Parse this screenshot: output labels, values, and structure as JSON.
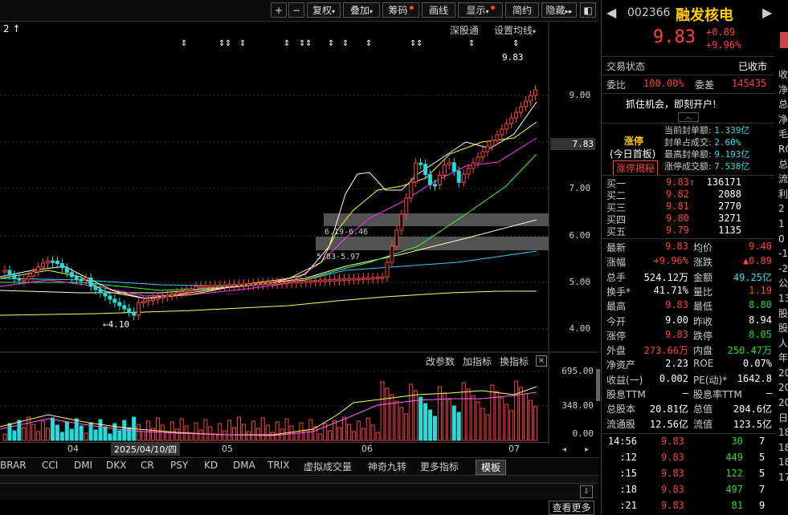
{
  "toolbar": {
    "plus": "+",
    "minus": "−",
    "fuquan": "复权",
    "diejia": "叠加",
    "chouma": "筹码",
    "huaxian": "画线",
    "xianshi": "显示",
    "jianling": "简约",
    "yincang": "隐藏"
  },
  "chart": {
    "top_left_indicator": "2 ↑",
    "shengutong": "深股通",
    "setting_ma": "设置均线",
    "y_ticks": [
      "9.00",
      "8.00",
      "7.00",
      "6.00",
      "5.00",
      "4.00"
    ],
    "current_price_tag": "7.83",
    "high_label": "9.83",
    "low_label": "4.10",
    "gap1_label": "6.19-6.46",
    "gap2_label": "5.83-5.97",
    "vol_ticks": [
      "695.00",
      "348.00",
      "0.00"
    ],
    "vol_tools": {
      "gaicanshu": "改参数",
      "jiazhibiao": "加指标",
      "huanzhibiao": "换指标"
    },
    "x_labels": [
      "04",
      "2025/04/10/四",
      "05",
      "06",
      "07"
    ],
    "event_marks": [
      "⇕",
      "⇕",
      "⇕",
      "⇕",
      "⇕",
      "⇕",
      "⇕",
      "⇕",
      "⇕",
      "⇕",
      "⇕",
      "⇕",
      "⇕",
      "⇕"
    ]
  },
  "bottom_tabs": [
    "BRAR",
    "CCI",
    "DMI",
    "DKX",
    "CR",
    "PSY",
    "KD",
    "DMA",
    "TRIX",
    "虚拟成交量",
    "神奇九转",
    "更多指标",
    "模板"
  ],
  "bottom_more": "查看更多",
  "stock": {
    "code": "002366",
    "name": "融发核电",
    "price": "9.83",
    "change": "+0.89",
    "change_pct": "+9.96%",
    "trade_status_label": "交易状态",
    "trade_status": "已收市",
    "weibi_label": "委比",
    "weibi": "100.00%",
    "weicha_label": "委差",
    "weicha": "145435",
    "ad": "抓住机会，即刻开户!",
    "limit_title": "涨停",
    "limit_sub": "(今日首板)",
    "limit_btn": "涨停揭秘",
    "seal_rows": [
      {
        "label": "当前封单额:",
        "value": "1.339亿"
      },
      {
        "label": "封单占成交:",
        "value": "2.60%"
      },
      {
        "label": "最高封单额:",
        "value": "9.193亿"
      },
      {
        "label": "涨停成交额:",
        "value": "7.538亿"
      }
    ],
    "buy_orders": [
      {
        "label": "买一",
        "price": "9.83↑",
        "vol": "136171"
      },
      {
        "label": "买二",
        "price": "9.82",
        "vol": "2088"
      },
      {
        "label": "买三",
        "price": "9.81",
        "vol": "2770"
      },
      {
        "label": "买四",
        "price": "9.80",
        "vol": "3271"
      },
      {
        "label": "买五",
        "price": "9.79",
        "vol": "1135"
      }
    ],
    "quote_rows": [
      {
        "l1": "最新",
        "v1": "9.83",
        "l2": "均价",
        "v2": "9.40"
      },
      {
        "l1": "涨幅",
        "v1": "+9.96%",
        "l2": "涨跌",
        "v2": "▲0.89"
      },
      {
        "l1": "总手",
        "v1": "524.12万",
        "l2": "金额",
        "v2": "49.25亿"
      },
      {
        "l1": "换手*",
        "v1": "41.71%",
        "l2": "量比",
        "v2": "1.19"
      },
      {
        "l1": "最高",
        "v1": "9.83",
        "l2": "最低",
        "v2": "8.80"
      },
      {
        "l1": "今开",
        "v1": "9.00",
        "l2": "昨收",
        "v2": "8.94"
      },
      {
        "l1": "涨停",
        "v1": "9.83",
        "l2": "跌停",
        "v2": "8.05"
      },
      {
        "l1": "外盘",
        "v1": "273.66万",
        "l2": "内盘",
        "v2": "250.47万"
      },
      {
        "l1": "净资产",
        "v1": "2.23",
        "l2": "ROE",
        "v2": "0.07%"
      },
      {
        "l1": "收益(一)",
        "v1": "0.002",
        "l2": "PE(动)*",
        "v2": "1642.8"
      },
      {
        "l1": "股息TTM",
        "v1": "—",
        "l2": "股息率TTM",
        "v2": "—"
      },
      {
        "l1": "总股本",
        "v1": "20.81亿",
        "l2": "总值",
        "v2": "204.6亿"
      },
      {
        "l1": "流通股",
        "v1": "12.56亿",
        "l2": "流值",
        "v2": "123.5亿"
      }
    ],
    "ticks": [
      {
        "time": "14:56",
        "price": "9.83",
        "vol": "30",
        "n": "7"
      },
      {
        "time": ":12",
        "price": "9.83",
        "vol": "449",
        "n": "5"
      },
      {
        "time": ":15",
        "price": "9.83",
        "vol": "122",
        "n": "5"
      },
      {
        "time": ":18",
        "price": "9.83",
        "vol": "497",
        "n": "7"
      },
      {
        "time": ":21",
        "price": "9.83",
        "vol": "81",
        "n": "9"
      }
    ],
    "edge_chars": [
      "收",
      "净",
      "总",
      "净",
      "毛",
      "RO",
      "总",
      "流",
      "利",
      "2",
      "1",
      "0",
      "-1",
      "-2",
      "公",
      "13",
      "股",
      "股",
      "人",
      "年",
      "20",
      "20",
      "20",
      "日",
      "18",
      "18",
      "18",
      "17"
    ]
  }
}
